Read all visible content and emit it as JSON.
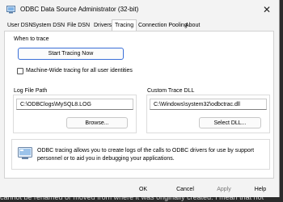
{
  "window": {
    "title": "ODBC Data Source Administrator (32-bit)"
  },
  "tabs": [
    {
      "label": "User DSN"
    },
    {
      "label": "System DSN"
    },
    {
      "label": "File DSN"
    },
    {
      "label": "Drivers"
    },
    {
      "label": "Tracing"
    },
    {
      "label": "Connection Pooling"
    },
    {
      "label": "About"
    }
  ],
  "when_to_trace": {
    "label": "When to trace",
    "start_button": "Start Tracing Now",
    "machine_wide_label": "Machine-Wide tracing for all user identities",
    "machine_wide_checked": false
  },
  "log_file": {
    "label": "Log File Path",
    "value": "C:\\ODBClogs\\MySQL8.LOG",
    "browse_button": "Browse..."
  },
  "custom_dll": {
    "label": "Custom Trace DLL",
    "value": "C:\\Windows\\system32\\odbctrac.dll",
    "select_button": "Select DLL..."
  },
  "info": {
    "text": "ODBC tracing allows you to create logs of the calls to ODBC drivers for use by support personnel or to aid you in debugging your applications."
  },
  "footer": {
    "ok": "OK",
    "cancel": "Cancel",
    "apply": "Apply",
    "help": "Help"
  },
  "background": {
    "partial_text": "cannot be renamed or moved from where it was originally created. I mean that not"
  },
  "colors": {
    "accent": "#3a6fd8",
    "window_bg": "#f3f3f3",
    "panel_bg": "#ffffff",
    "desktop_bg": "#2b2b2b"
  }
}
